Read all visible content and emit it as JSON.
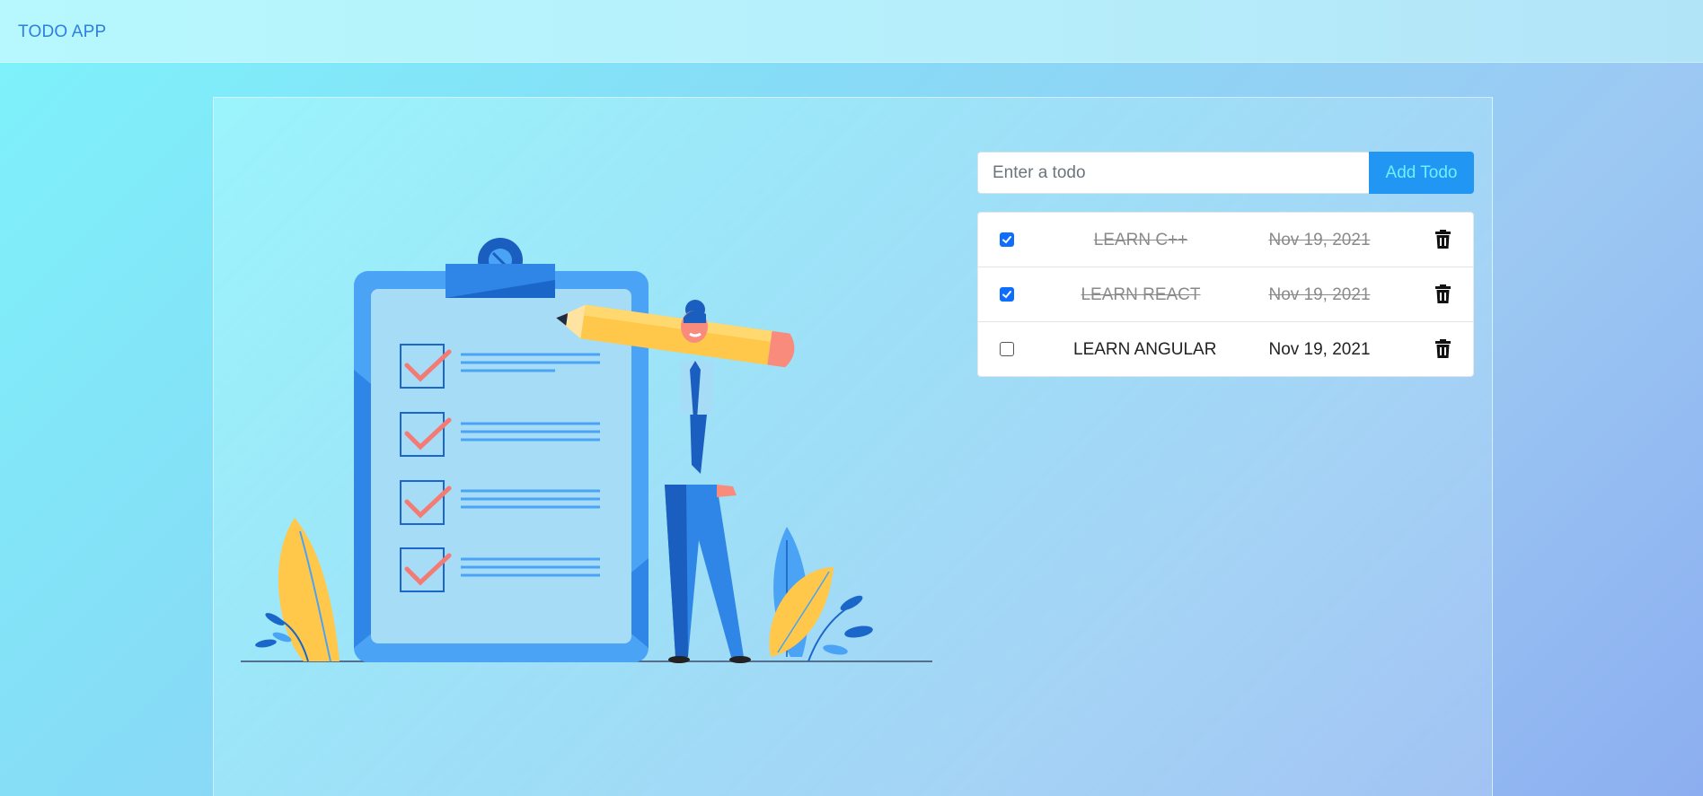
{
  "navbar": {
    "brand": "TODO APP"
  },
  "form": {
    "placeholder": "Enter a todo",
    "value": "",
    "add_label": "Add Todo"
  },
  "todos": [
    {
      "title": "LEARN C++",
      "date": "Nov 19, 2021",
      "completed": true
    },
    {
      "title": "LEARN REACT",
      "date": "Nov 19, 2021",
      "completed": true
    },
    {
      "title": "LEARN ANGULAR",
      "date": "Nov 19, 2021",
      "completed": false
    }
  ],
  "colors": {
    "accent": "#2196f3",
    "brand_text": "#2f7ee3",
    "checkbox_checked": "#0d6efd",
    "illustration_blue": "#4aa3f5",
    "illustration_yellow": "#ffc84a",
    "illustration_check": "#f47b74"
  },
  "icons": [
    "trash-icon",
    "checkmark-icon"
  ]
}
